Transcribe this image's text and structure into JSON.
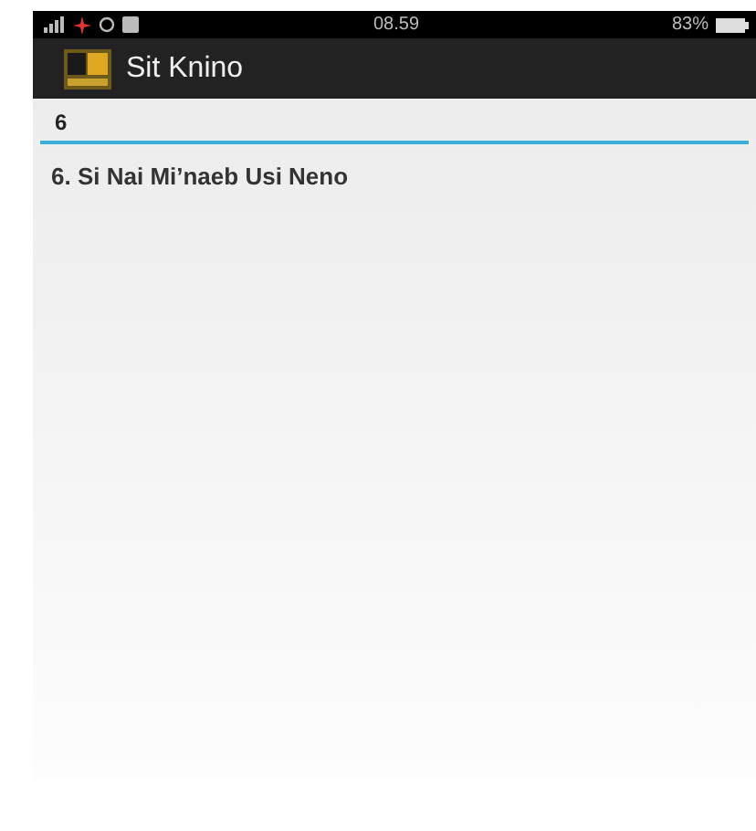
{
  "status_bar": {
    "time": "08.59",
    "battery": "83%"
  },
  "app_bar": {
    "title": "Sit Knino"
  },
  "search": {
    "value": "6"
  },
  "results": [
    {
      "label": "6. Si Nai Mi’naeb Usi Neno"
    }
  ]
}
